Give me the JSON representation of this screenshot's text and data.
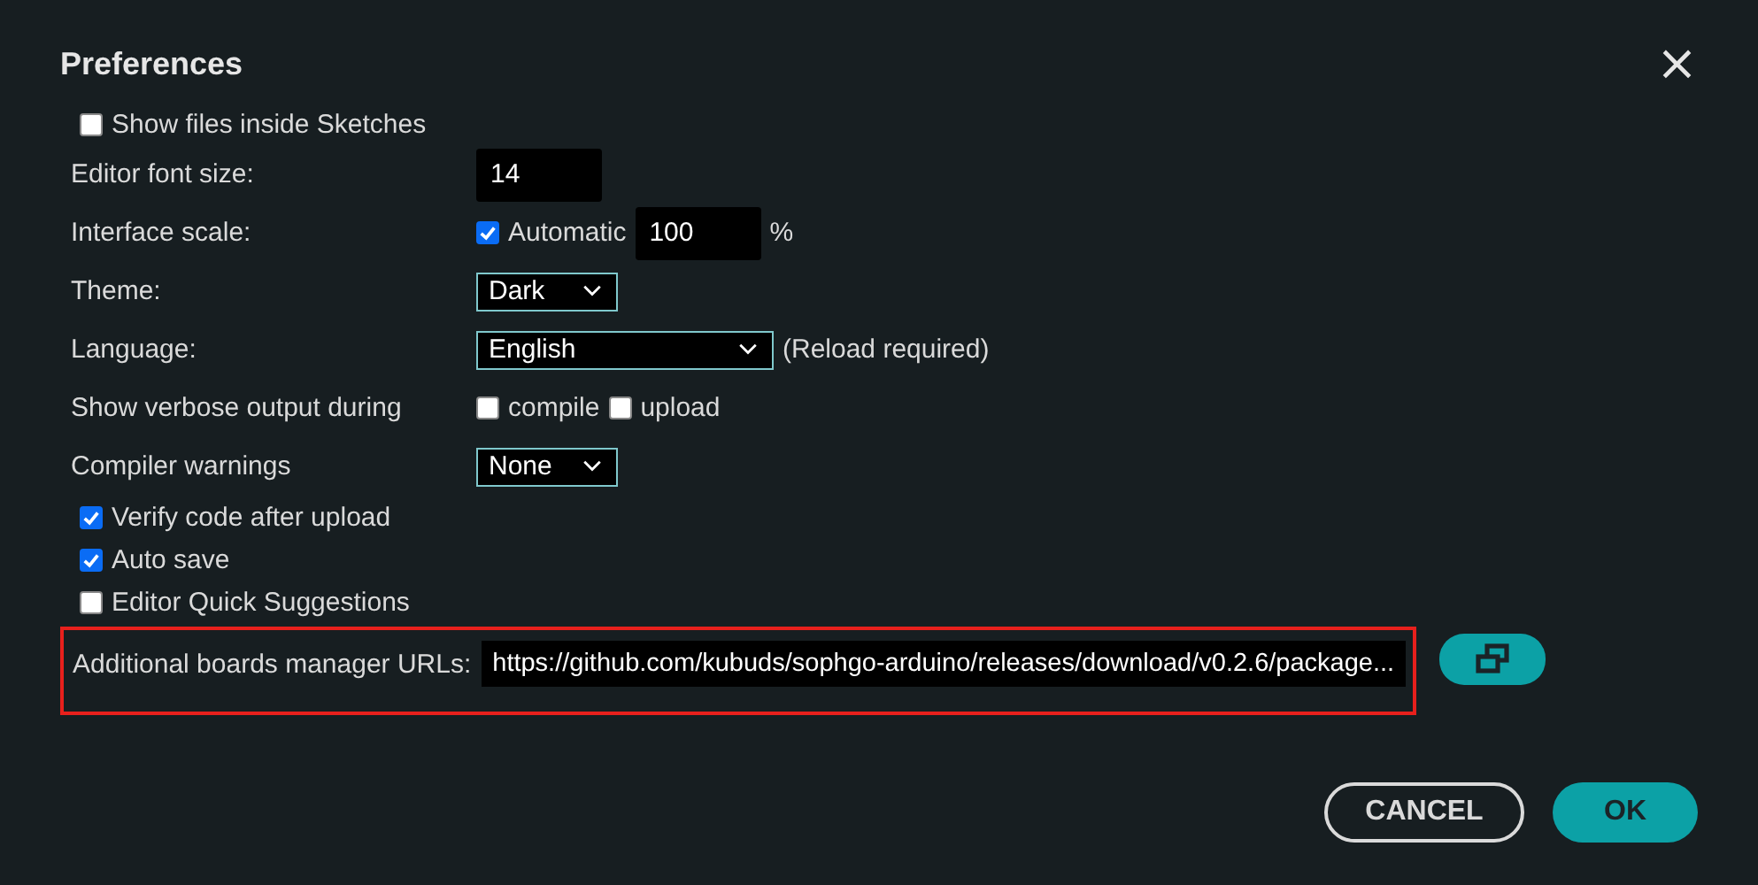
{
  "dialog": {
    "title": "Preferences",
    "close": "×"
  },
  "rows": [
    {
      "kind": "checkbox",
      "label": "Show files inside Sketches",
      "checked": false
    },
    {
      "kind": "number",
      "label": "Editor font size:",
      "value": "14"
    },
    {
      "kind": "scale",
      "label": "Interface scale:",
      "auto_label": "Automatic",
      "checked": true,
      "value": "100",
      "unit": "%"
    },
    {
      "kind": "select",
      "label": "Theme:",
      "value": "Dark"
    },
    {
      "kind": "select",
      "label": "Language:",
      "value": "English",
      "note": "(Reload required)"
    },
    {
      "kind": "verbose",
      "label": "Show verbose output during",
      "options": [
        {
          "label": "compile",
          "checked": false
        },
        {
          "label": "upload",
          "checked": false
        }
      ]
    },
    {
      "kind": "select",
      "label": "Compiler warnings",
      "value": "None"
    },
    {
      "kind": "checkbox",
      "label": "Verify code after upload",
      "checked": true
    },
    {
      "kind": "checkbox",
      "label": "Auto save",
      "checked": true
    },
    {
      "kind": "checkbox",
      "label": "Editor Quick Suggestions",
      "checked": false
    },
    {
      "kind": "url",
      "label": "Additional boards manager URLs:",
      "value": "https://github.com/kubuds/sophgo-arduino/releases/download/v0.2.6/package...",
      "highlighted": true
    }
  ],
  "buttons": [
    {
      "label": "CANCEL",
      "kind": "secondary"
    },
    {
      "label": "OK",
      "kind": "primary"
    }
  ]
}
